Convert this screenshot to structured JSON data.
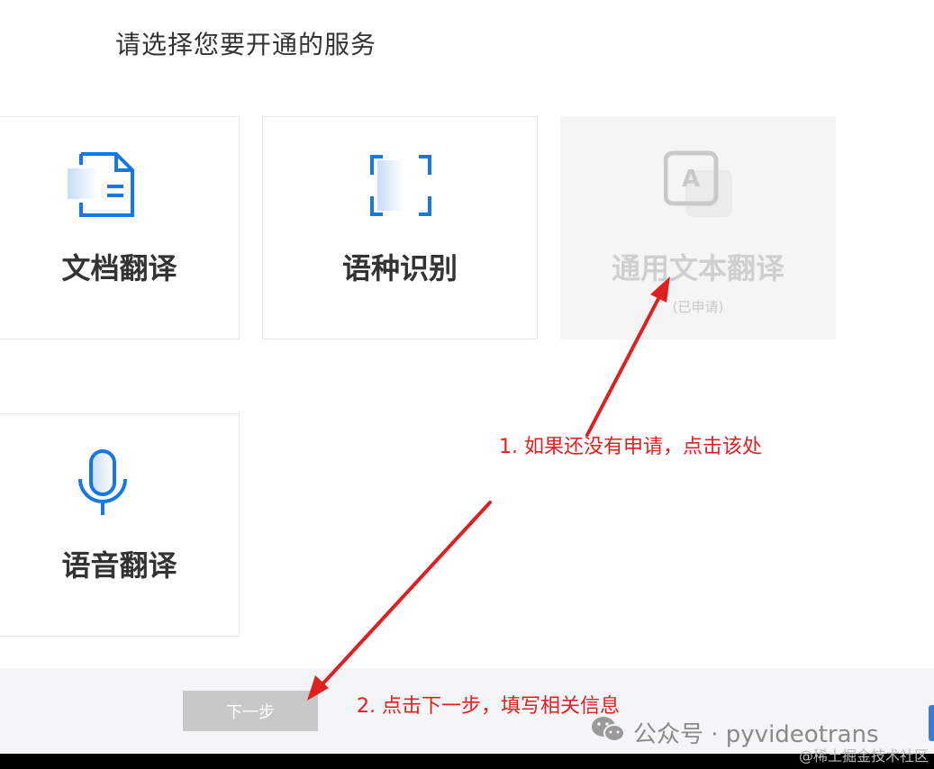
{
  "page": {
    "title": "请选择您要开通的服务"
  },
  "services": [
    {
      "id": "doc",
      "label": "文档翻译",
      "icon": "document-icon",
      "status": ""
    },
    {
      "id": "lang",
      "label": "语种识别",
      "icon": "scan-frame-icon",
      "status": ""
    },
    {
      "id": "text",
      "label": "通用文本翻译",
      "icon": "letter-a-icon",
      "status": "(已申请)"
    },
    {
      "id": "voice",
      "label": "语音翻译",
      "icon": "microphone-icon",
      "status": ""
    }
  ],
  "footer": {
    "next_label": "下一步"
  },
  "annotations": {
    "note1": "1. 如果还没有申请，点击该处",
    "note2": "2. 点击下一步，填写相关信息",
    "color": "#e02020"
  },
  "watermark": {
    "primary": "公众号 · pyvideotrans",
    "secondary": "@稀土掘金技术社区",
    "icon": "wechat-icon"
  },
  "colors": {
    "accent": "#1677e6",
    "disabled": "#c8c8c8"
  }
}
